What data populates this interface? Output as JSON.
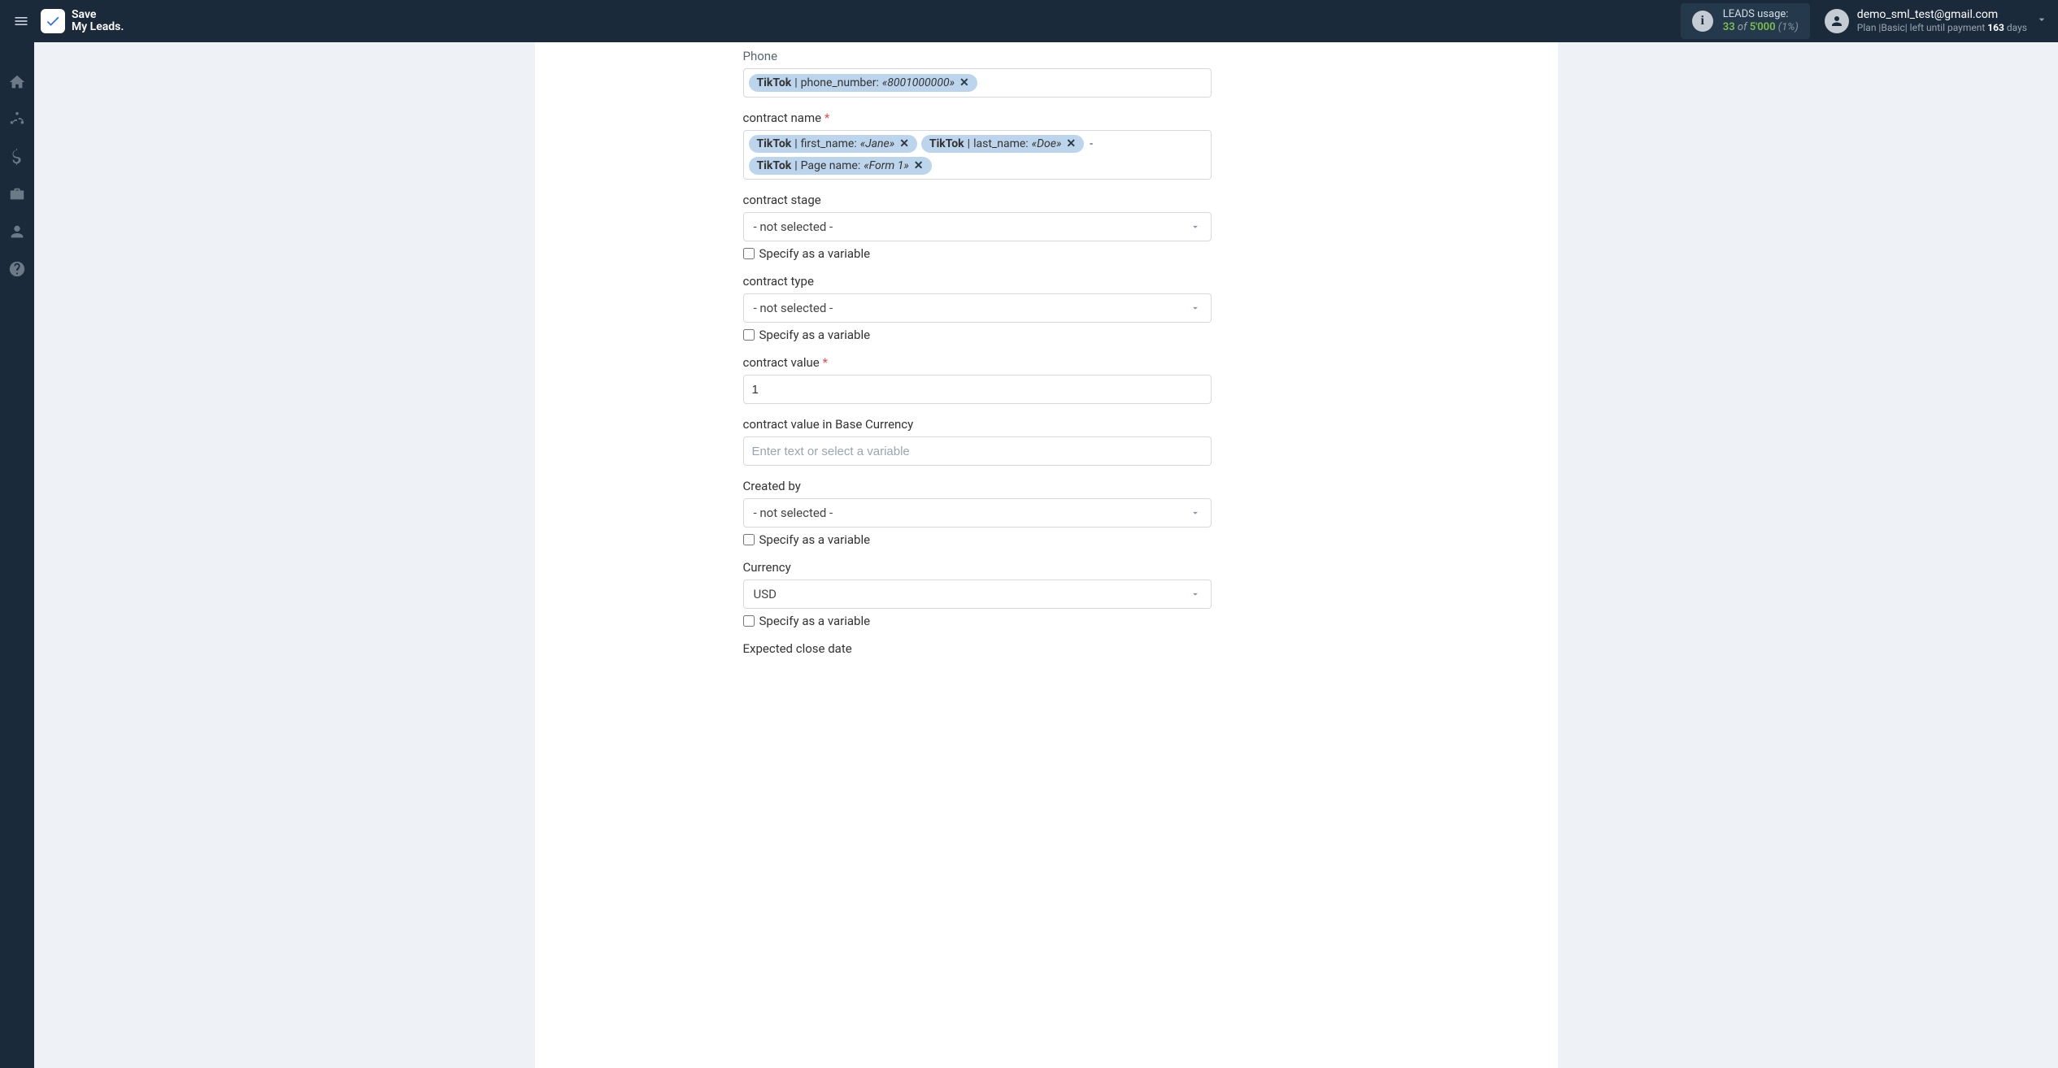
{
  "header": {
    "logo_line1": "Save",
    "logo_line2": "My Leads.",
    "usage": {
      "title": "LEADS usage:",
      "used": "33",
      "of": "of",
      "total": "5'000",
      "pct": "(1%)"
    },
    "account": {
      "email": "demo_sml_test@gmail.com",
      "plan_prefix": "Plan |",
      "plan_name": "Basic",
      "plan_mid": "| left until payment ",
      "days": "163",
      "days_suffix": " days"
    }
  },
  "form": {
    "phone": {
      "label": "Phone",
      "tag_source": "TikTok",
      "tag_field": "phone_number:",
      "tag_sample": "«8001000000»"
    },
    "contract_name": {
      "label": "contract name",
      "tags": [
        {
          "source": "TikTok",
          "field": "first_name:",
          "sample": "«Jane»"
        },
        {
          "source": "TikTok",
          "field": "last_name:",
          "sample": "«Doe»"
        }
      ],
      "separator": "-",
      "tail_tag": {
        "source": "TikTok",
        "field": "Page name:",
        "sample": "«Form 1»"
      }
    },
    "contract_stage": {
      "label": "contract stage",
      "value": "- not selected -",
      "var_label": "Specify as a variable"
    },
    "contract_type": {
      "label": "contract type",
      "value": "- not selected -",
      "var_label": "Specify as a variable"
    },
    "contract_value": {
      "label": "contract value",
      "value": "1"
    },
    "base_currency": {
      "label": "contract value in Base Currency",
      "placeholder": "Enter text or select a variable"
    },
    "created_by": {
      "label": "Created by",
      "value": "- not selected -",
      "var_label": "Specify as a variable"
    },
    "currency": {
      "label": "Currency",
      "value": "USD",
      "var_label": "Specify as a variable"
    },
    "expected_close": {
      "label": "Expected close date"
    }
  }
}
